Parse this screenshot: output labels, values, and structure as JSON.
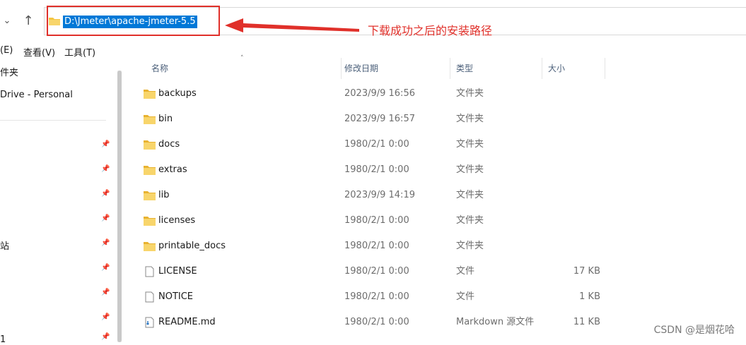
{
  "address": {
    "path": "D:\\Jmeter\\apache-jmeter-5.5",
    "annotation": "下载成功之后的安装路径"
  },
  "menu": [
    "(E)",
    "查看(V)",
    "工具(T)"
  ],
  "nav": {
    "items": [
      "件夹",
      "Drive - Personal",
      "站",
      "1"
    ]
  },
  "columns": {
    "name": "名称",
    "date": "修改日期",
    "type": "类型",
    "size": "大小"
  },
  "files": [
    {
      "name": "backups",
      "date": "2023/9/9 16:56",
      "type": "文件夹",
      "size": "",
      "icon": "folder-icon"
    },
    {
      "name": "bin",
      "date": "2023/9/9 16:57",
      "type": "文件夹",
      "size": "",
      "icon": "folder-icon"
    },
    {
      "name": "docs",
      "date": "1980/2/1 0:00",
      "type": "文件夹",
      "size": "",
      "icon": "folder-icon"
    },
    {
      "name": "extras",
      "date": "1980/2/1 0:00",
      "type": "文件夹",
      "size": "",
      "icon": "folder-icon"
    },
    {
      "name": "lib",
      "date": "2023/9/9 14:19",
      "type": "文件夹",
      "size": "",
      "icon": "folder-icon"
    },
    {
      "name": "licenses",
      "date": "1980/2/1 0:00",
      "type": "文件夹",
      "size": "",
      "icon": "folder-icon"
    },
    {
      "name": "printable_docs",
      "date": "1980/2/1 0:00",
      "type": "文件夹",
      "size": "",
      "icon": "folder-icon"
    },
    {
      "name": "LICENSE",
      "date": "1980/2/1 0:00",
      "type": "文件",
      "size": "17 KB",
      "icon": "file-icon"
    },
    {
      "name": "NOTICE",
      "date": "1980/2/1 0:00",
      "type": "文件",
      "size": "1 KB",
      "icon": "file-icon"
    },
    {
      "name": "README.md",
      "date": "1980/2/1 0:00",
      "type": "Markdown 源文件",
      "size": "11 KB",
      "icon": "markdown-file-icon"
    }
  ],
  "watermark": "CSDN @是烟花哈",
  "colors": {
    "selection": "#0078d7",
    "annotation": "#e0302a",
    "folder": "#f4c542"
  }
}
